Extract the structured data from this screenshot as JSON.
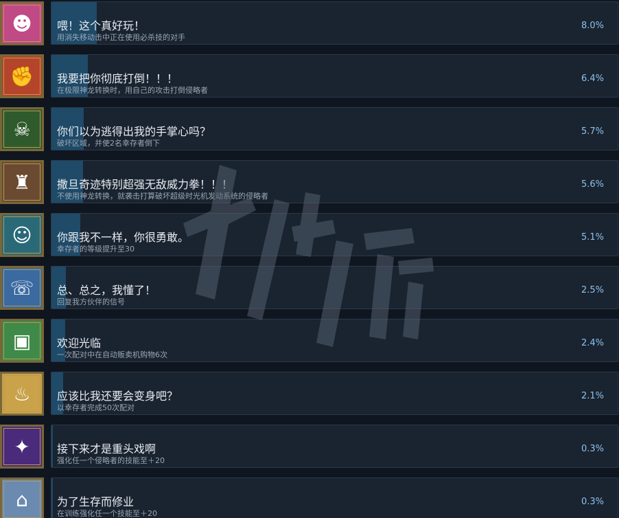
{
  "achievements": [
    {
      "title": "喂！这个真好玩！",
      "desc": "用消失移动击中正在使用必杀技的对手",
      "percent": "8.0%",
      "percent_value": 8.0,
      "icon": "pink-majin-icon",
      "icon_color": "#c04a86",
      "glyph": "☻"
    },
    {
      "title": "我要把你彻底打倒！！！",
      "desc": "在极限神龙转换时，用自己的攻击打倒侵略者",
      "percent": "6.4%",
      "percent_value": 6.4,
      "icon": "warrior-icon",
      "icon_color": "#b5452a",
      "glyph": "✊"
    },
    {
      "title": "你们以为逃得出我的手掌心吗？",
      "desc": "破坏区域，并使2名幸存者倒下",
      "percent": "5.7%",
      "percent_value": 5.7,
      "icon": "green-villain-icon",
      "icon_color": "#2f5a2c",
      "glyph": "☠"
    },
    {
      "title": "撒旦奇迹特别超强无敌威力拳！！！",
      "desc": "不使用神龙转换，就袭击打算破坏超级时光机发动系统的侵略者",
      "percent": "5.6%",
      "percent_value": 5.6,
      "icon": "statue-icon",
      "icon_color": "#6a4a30",
      "glyph": "♜"
    },
    {
      "title": "你跟我不一样，你很勇敢。",
      "desc": "幸存者的等级提升至30",
      "percent": "5.1%",
      "percent_value": 5.1,
      "icon": "scientist-icon",
      "icon_color": "#2a6a78",
      "glyph": "☺"
    },
    {
      "title": "总、总之，我懂了！",
      "desc": "回复我方伙伴的信号",
      "percent": "2.5%",
      "percent_value": 2.5,
      "icon": "signal-icon",
      "icon_color": "#3a6aa0",
      "glyph": "☏"
    },
    {
      "title": "欢迎光临",
      "desc": "一次配对中在自动贩卖机购物6次",
      "percent": "2.4%",
      "percent_value": 2.4,
      "icon": "vending-machine-icon",
      "icon_color": "#3f8a48",
      "glyph": "▣"
    },
    {
      "title": "应该比我还要会变身吧？",
      "desc": "以幸存者完成50次配对",
      "percent": "2.1%",
      "percent_value": 2.1,
      "icon": "pig-icon",
      "icon_color": "#c9a24a",
      "glyph": "♨"
    },
    {
      "title": "接下来才是重头戏啊",
      "desc": "强化任一个侵略者的技能至＋20",
      "percent": "0.3%",
      "percent_value": 0.3,
      "icon": "dark-armor-icon",
      "icon_color": "#4a2a7a",
      "glyph": "✦"
    },
    {
      "title": "为了生存而修业",
      "desc": "在训练强化任一个技能至＋20",
      "percent": "0.3%",
      "percent_value": 0.3,
      "icon": "dome-icon",
      "icon_color": "#6a8ab0",
      "glyph": "⌂"
    }
  ],
  "watermark_text": "游侠网"
}
